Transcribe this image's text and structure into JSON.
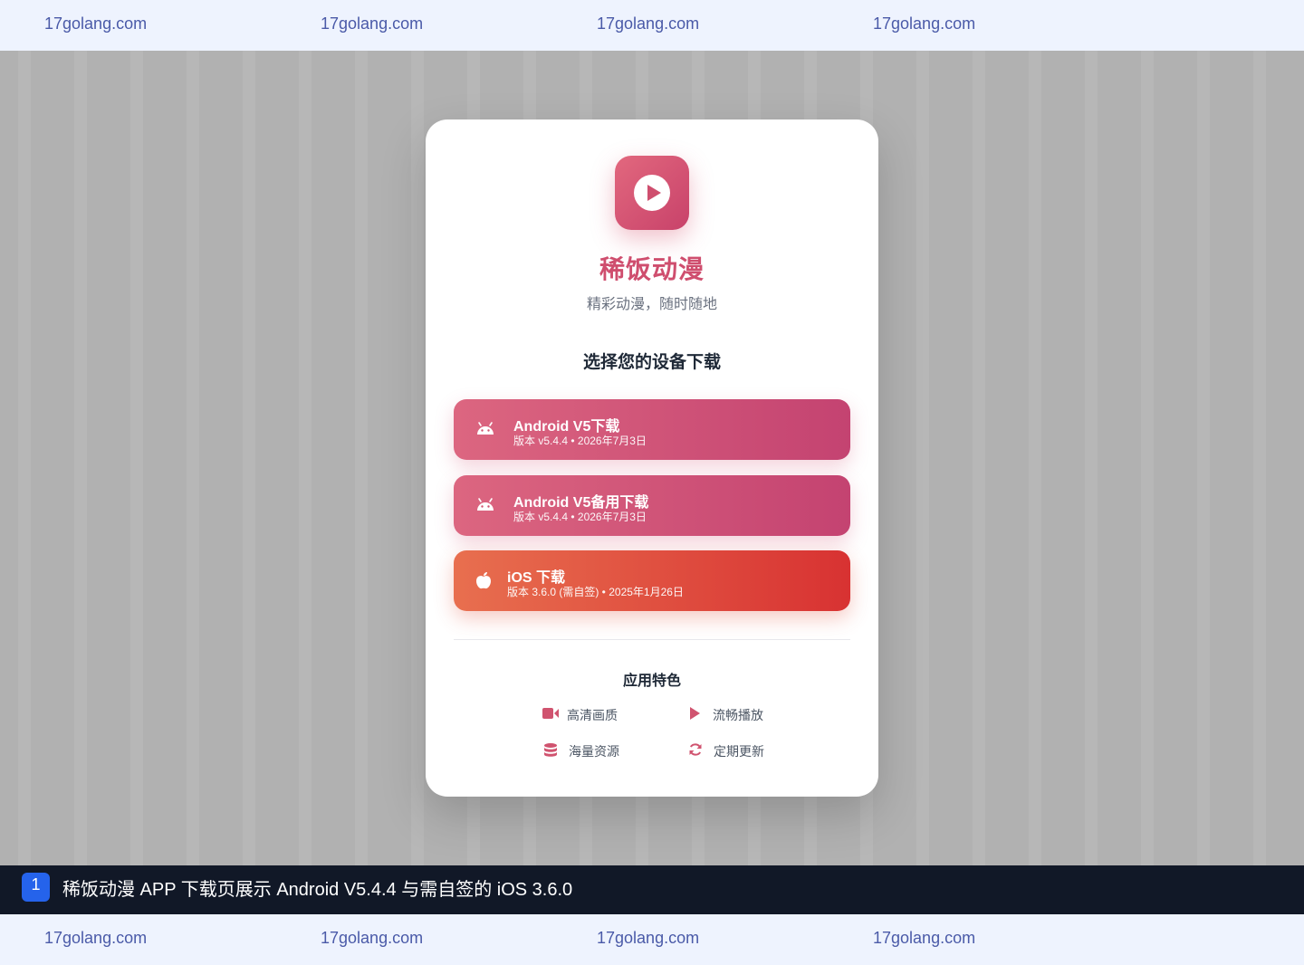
{
  "watermark": {
    "text": [
      "17golang.com",
      "17golang.com",
      "17golang.com",
      "17golang.com"
    ]
  },
  "app": {
    "name": "稀饭动漫",
    "tagline": "精彩动漫，随时随地"
  },
  "download": {
    "section_title": "选择您的设备下载",
    "buttons": [
      {
        "title": "Android V5下载",
        "subtitle": "版本 v5.4.4 • 2026年7月3日",
        "icon": "android-icon"
      },
      {
        "title": "Android V5备用下载",
        "subtitle": "版本 v5.4.4 • 2026年7月3日",
        "icon": "android-icon"
      },
      {
        "title": "iOS 下载",
        "subtitle": "版本 3.6.0 (需自签) • 2025年1月26日",
        "icon": "apple-icon"
      }
    ]
  },
  "features": {
    "title": "应用特色",
    "items": [
      {
        "label": "高清画质",
        "icon": "video-camera-icon"
      },
      {
        "label": "流畅播放",
        "icon": "play-icon"
      },
      {
        "label": "海量资源",
        "icon": "database-icon"
      },
      {
        "label": "定期更新",
        "icon": "refresh-icon"
      }
    ]
  },
  "caption": {
    "index": "1",
    "text": "稀饭动漫 APP 下载页展示 Android V5.4.4 与需自签的 iOS 3.6.0"
  },
  "colors": {
    "brand": "#cf4e6e",
    "android_button": "#d0536f",
    "ios_button": "#e0483f",
    "caption_bar": "#111827",
    "caption_badge": "#2563eb",
    "watermark_bar": "#eef3fe"
  }
}
